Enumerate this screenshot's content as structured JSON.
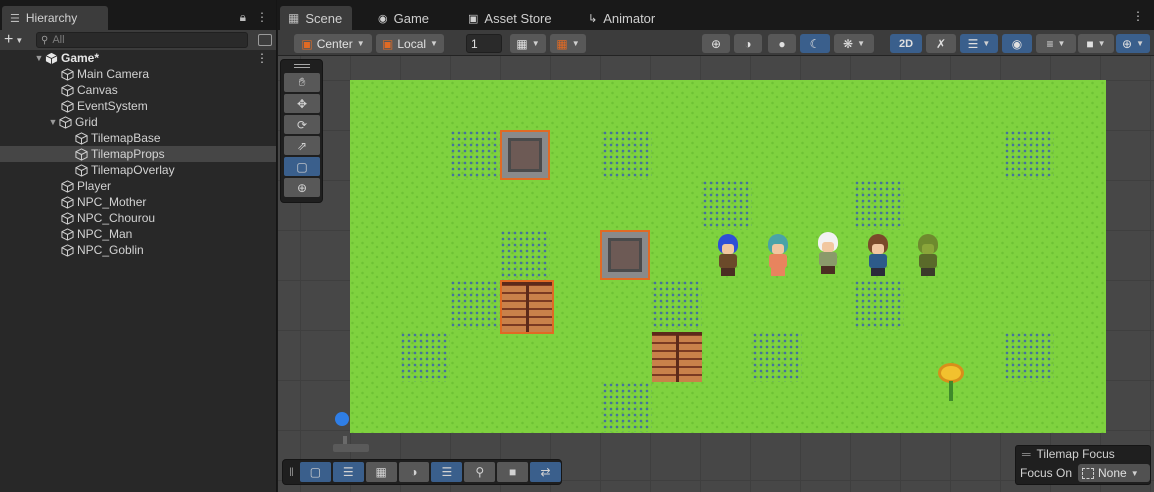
{
  "hierarchy": {
    "tab_label": "Hierarchy",
    "search_placeholder": "All",
    "scene_name": "Game*",
    "items": [
      {
        "label": "Main Camera"
      },
      {
        "label": "Canvas"
      },
      {
        "label": "EventSystem"
      },
      {
        "label": "Grid"
      },
      {
        "label": "TilemapBase"
      },
      {
        "label": "TilemapProps"
      },
      {
        "label": "TilemapOverlay"
      },
      {
        "label": "Player"
      },
      {
        "label": "NPC_Mother"
      },
      {
        "label": "NPC_Chourou"
      },
      {
        "label": "NPC_Man"
      },
      {
        "label": "NPC_Goblin"
      }
    ],
    "selected_item": "TilemapProps"
  },
  "tabs": {
    "scene": "Scene",
    "game": "Game",
    "asset_store": "Asset Store",
    "animator": "Animator"
  },
  "scene_toolbar": {
    "pivot": "Center",
    "space": "Local",
    "grid_size": "1",
    "mode_2d": "2D"
  },
  "tilemap_focus": {
    "title": "Tilemap Focus",
    "label": "Focus On",
    "value": "None"
  },
  "colors": {
    "accent": "#3a5f8c",
    "selection_outline": "#e06a24",
    "grass": "#7fd23f"
  }
}
